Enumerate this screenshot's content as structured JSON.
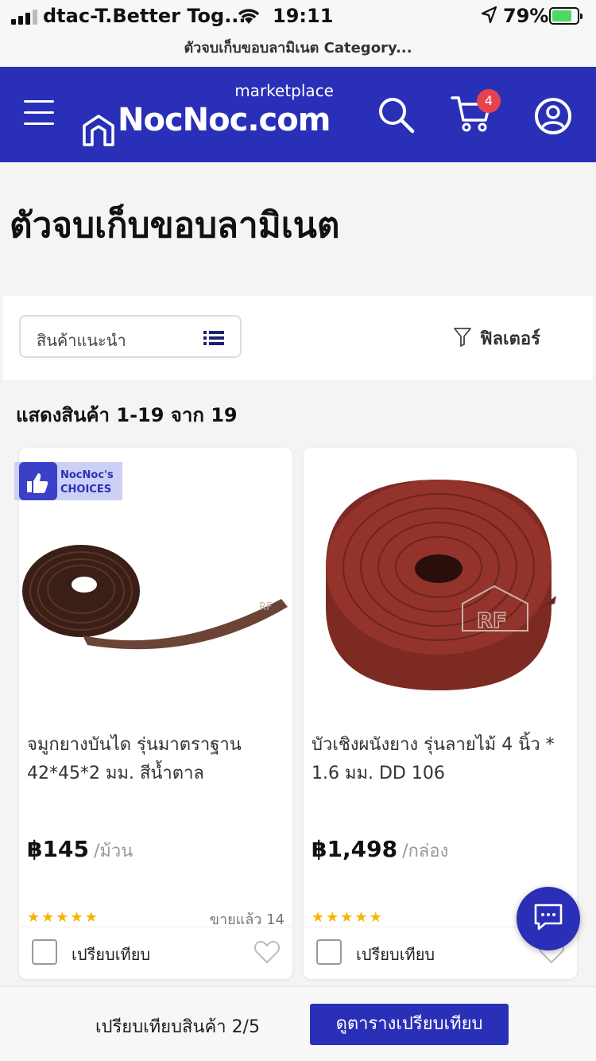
{
  "status_bar": {
    "carrier": "dtac-T.Better Tog...",
    "time": "19:11",
    "battery": "79%"
  },
  "url_bar": {
    "title": "ตัวจบเก็บขอบลามิเนต Category..."
  },
  "header": {
    "logo_text": "NocNoc.com",
    "logo_subtext": "marketplace",
    "cart_count": "4",
    "brand_color": "#2a2fb8"
  },
  "page": {
    "title": "ตัวจบเก็บขอบลามิเนต"
  },
  "toolbar": {
    "sort_value": "สินค้าแนะนำ",
    "filter_label": "ฟิลเตอร์"
  },
  "results": {
    "count_text": "แสดงสินค้า 1-19 จาก 19"
  },
  "products": [
    {
      "badge_line1": "NocNoc's",
      "badge_line2": "CHOICES",
      "name": "จมูกยางบันได รุ่นมาตราฐาน 42*45*2 มม. สีน้ำตาล",
      "price": "฿145",
      "unit": "/ม้วน",
      "rating": 5,
      "sold": "ขายแล้ว 14",
      "compare_label": "เปรียบเทียบ",
      "watermark": "RF"
    },
    {
      "name": "บัวเชิงผนังยาง รุ่นลายไม้ 4  นิ้ว * 1.6 มม. DD 106",
      "price": "฿1,498",
      "unit": "/กล่อง",
      "rating": 5,
      "sold": "ข",
      "compare_label": "เปรียบเทียบ",
      "watermark": "RF"
    }
  ],
  "compare_bar": {
    "text": "เปรียบเทียบสินค้า 2/5",
    "button_label": "ดูตารางเปรียบเทียบ"
  },
  "icons": [
    "hamburger-icon",
    "search-icon",
    "cart-icon",
    "user-icon",
    "list-icon",
    "filter-icon",
    "heart-icon",
    "chat-icon",
    "star-icon",
    "thumbs-up-icon"
  ]
}
